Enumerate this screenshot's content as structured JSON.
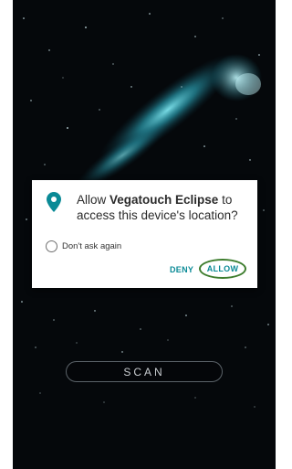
{
  "dialog": {
    "message_prefix": "Allow ",
    "app_name": "Vegatouch Eclipse",
    "message_suffix": " to access this device's location?",
    "dont_ask_label": "Don't ask again",
    "deny_label": "DENY",
    "allow_label": "ALLOW",
    "accent_color": "#0a8a96",
    "icon": "location-pin-icon"
  },
  "main": {
    "scan_label": "SCAN"
  },
  "colors": {
    "background": "#05080b",
    "dialog_background": "#ffffff",
    "highlight_ring": "#3e7d2e"
  }
}
